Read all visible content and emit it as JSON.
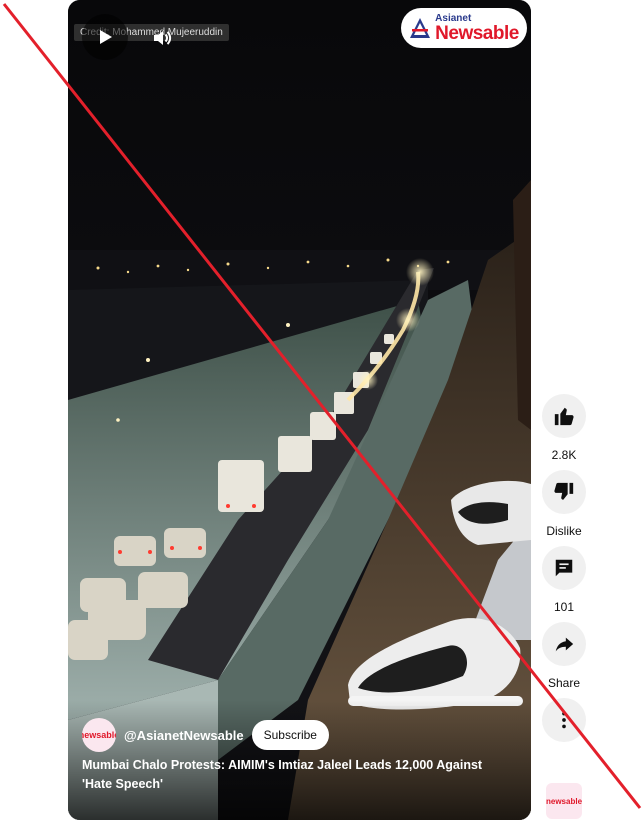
{
  "video": {
    "credit": "Credit: Mohammed Mujeeruddin",
    "brand": {
      "top": "Asianet",
      "main": "Newsable"
    },
    "channel_handle": "@AsianetNewsable",
    "subscribe_label": "Subscribe",
    "title": "Mumbai Chalo Protests: AIMIM's Imtiaz Jaleel Leads 12,000 Against 'Hate Speech'",
    "avatar_text": "newsable"
  },
  "actions": {
    "like_count": "2.8K",
    "dislike_label": "Dislike",
    "comment_count": "101",
    "share_label": "Share"
  },
  "colors": {
    "slash": "#e3202b",
    "brand_red": "#e0182a",
    "brand_blue": "#2a3a8c"
  },
  "icons": [
    "play-icon",
    "volume-icon",
    "like-icon",
    "dislike-icon",
    "comment-icon",
    "share-icon",
    "more-icon"
  ]
}
